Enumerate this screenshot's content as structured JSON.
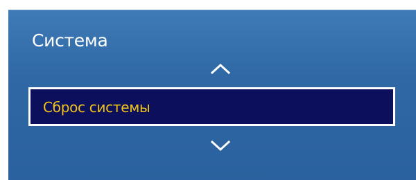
{
  "menu": {
    "title": "Система",
    "selected_item": {
      "label": "Сброс системы"
    }
  },
  "icons": {
    "up": "chevron-up-icon",
    "down": "chevron-down-icon"
  },
  "colors": {
    "panel_blue": "#2f68a5",
    "selection_bg": "#0b0f5c",
    "selection_text": "#f2c318",
    "selection_border": "#ffffff"
  }
}
